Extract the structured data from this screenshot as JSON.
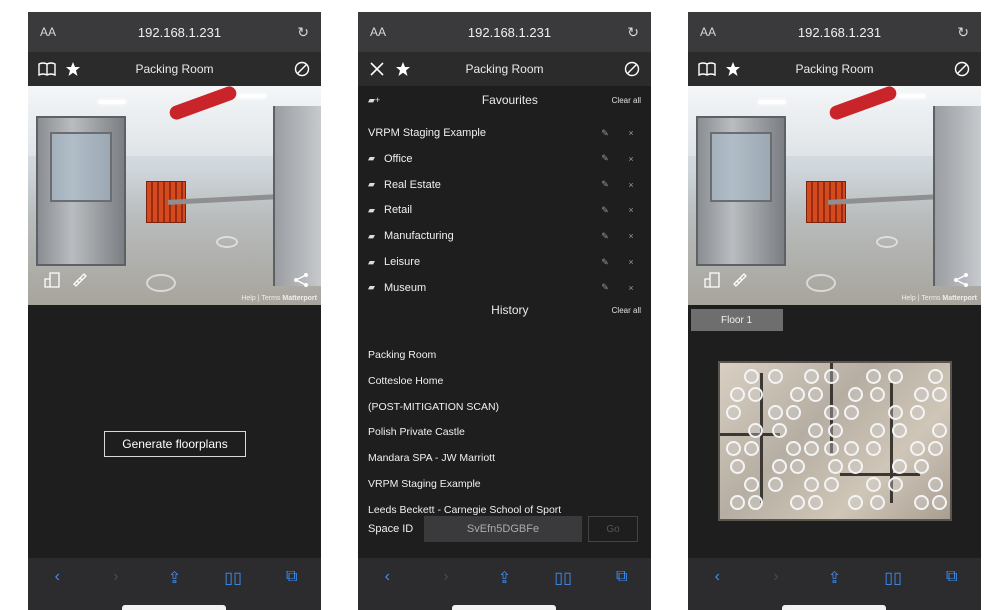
{
  "browser": {
    "aa_label": "AA",
    "url": "192.168.1.231",
    "reload_icon": "reload-icon"
  },
  "header": {
    "title": "Packing Room"
  },
  "scene": {
    "help": "Help",
    "sep": "|",
    "terms": "Terms",
    "brand": "Matterport"
  },
  "screen1": {
    "generate_label": "Generate floorplans"
  },
  "screen2": {
    "favourites": {
      "title": "Favourites",
      "clear_label": "Clear all",
      "items": [
        {
          "label": "VRPM Staging Example",
          "folder": false
        },
        {
          "label": "Office",
          "folder": true
        },
        {
          "label": "Real Estate",
          "folder": true
        },
        {
          "label": "Retail",
          "folder": true
        },
        {
          "label": "Manufacturing",
          "folder": true
        },
        {
          "label": "Leisure",
          "folder": true
        },
        {
          "label": "Museum",
          "folder": true
        }
      ]
    },
    "history": {
      "title": "History",
      "clear_label": "Clear all",
      "items": [
        "Packing Room",
        "Cottesloe Home",
        "(POST-MITIGATION SCAN)",
        "Polish Private Castle",
        "Mandara SPA - JW Marriott",
        "VRPM Staging Example",
        "Leeds Beckett - Carnegie School of Sport"
      ]
    },
    "space_id": {
      "label": "Space ID",
      "value": "SvEfn5DGBFe",
      "go_label": "Go"
    }
  },
  "screen3": {
    "floor_label": "Floor 1"
  },
  "colors": {
    "accent": "#3e8ef7",
    "duct_red": "#c9242a",
    "guard_orange": "#d24a1e"
  }
}
